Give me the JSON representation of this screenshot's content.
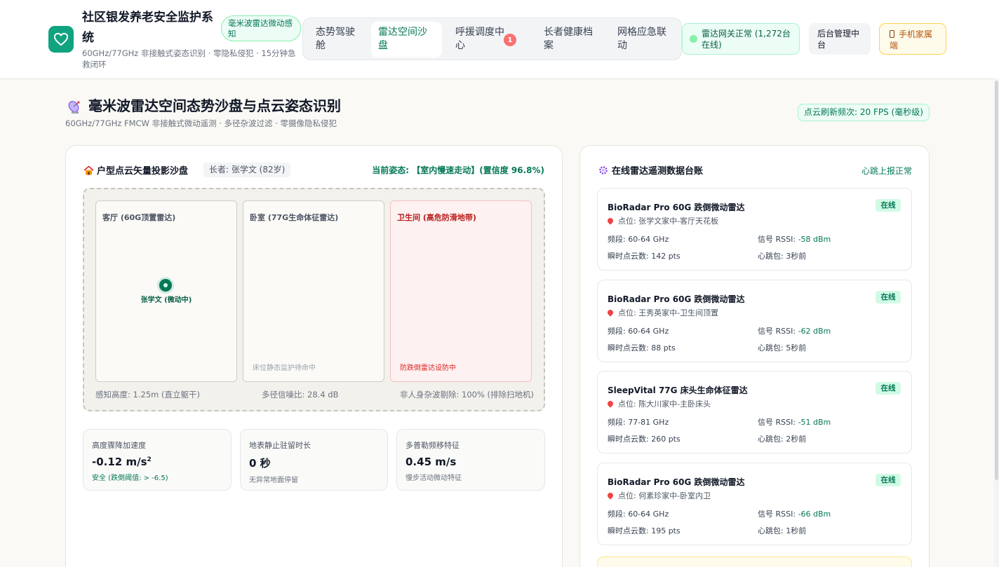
{
  "header": {
    "app_title": "社区银发养老安全监护系统",
    "app_subtitle": "60GHz/77GHz 非接触式姿态识别 · 零隐私侵犯 · 15分钟急救闭环",
    "mmwave_badge": "毫米波雷达微动感知",
    "nav": [
      {
        "label": "态势驾驶舱",
        "active": false
      },
      {
        "label": "雷达空间沙盘",
        "active": true
      },
      {
        "label": "呼援调度中心",
        "active": false,
        "badge": "1"
      },
      {
        "label": "长者健康档案",
        "active": false
      },
      {
        "label": "网格应急联动",
        "active": false
      }
    ],
    "gateway_status": "雷达网关正常 (1,272台在线)",
    "admin_button": "后台管理中台",
    "family_button": "手机家属端",
    "family_icon": "phone-icon",
    "logo_icon": "heart-icon"
  },
  "section": {
    "title": "毫米波雷达空间态势沙盘与点云姿态识别",
    "subtitle": "60GHz/77GHz FMCW 非接触式微动遥测 · 多径杂波过滤 · 零摄像隐私侵犯",
    "fps_badge": "点云刷新频次: 20 FPS (毫秒级)",
    "icon": "satellite-dish-icon"
  },
  "sandbox": {
    "title": "户型点云矢量投影沙盘",
    "icon": "house-icon",
    "elder_tag": "长者: 张学文 (82岁)",
    "posture_text": "当前姿态: 【室内慢速走动】(置信度 96.8%)",
    "rooms": [
      {
        "name": "客厅 (60G顶置雷达)",
        "note": ""
      },
      {
        "name": "卧室 (77G生命体征雷达)",
        "note": "床位静态监护待命中"
      },
      {
        "name": "卫生间 (高危防滑地带)",
        "note": "防跌倒雷达设防中"
      }
    ],
    "target_label": "张学文 (微动中)",
    "footer": {
      "height": "感知高度: 1.25m (直立躯干)",
      "snr": "多径信噪比: 28.4 dB",
      "clutter": "非人身杂波剔除: 100% (排除扫地机)"
    }
  },
  "metrics": [
    {
      "label": "高度骤降加速度",
      "value": "-0.12 m/s",
      "sup": "2",
      "note": "安全 (跌倒阈值: > -6.5)",
      "ok": true
    },
    {
      "label": "地表静止驻留时长",
      "value": "0 秒",
      "sup": "",
      "note": "无异常地面停留",
      "ok": false
    },
    {
      "label": "多普勒频移特征",
      "value": "0.45 m/s",
      "sup": "",
      "note": "慢步活动微动特征",
      "ok": false
    }
  ],
  "ledger": {
    "title": "在线雷达遥测数据台账",
    "icon": "gear-icon",
    "heartbeat": "心跳上报正常",
    "labels": {
      "band": "频段: ",
      "rssi": "信号 RSSI: ",
      "points": "瞬时点云数: ",
      "hb": "心跳包: ",
      "loc": "点位: "
    },
    "devices": [
      {
        "name": "BioRadar Pro 60G 跌倒微动雷达",
        "status": "在线",
        "location": "张学文家中-客厅天花板",
        "band": "60-64 GHz",
        "rssi": "-58 dBm",
        "points": "142 pts",
        "heartbeat": "3秒前"
      },
      {
        "name": "BioRadar Pro 60G 跌倒微动雷达",
        "status": "在线",
        "location": "王秀英家中-卫生间顶置",
        "band": "60-64 GHz",
        "rssi": "-62 dBm",
        "points": "88 pts",
        "heartbeat": "5秒前"
      },
      {
        "name": "SleepVital 77G 床头生命体征雷达",
        "status": "在线",
        "location": "陈大川家中-主卧床头",
        "band": "77-81 GHz",
        "rssi": "-51 dBm",
        "points": "260 pts",
        "heartbeat": "2秒前"
      },
      {
        "name": "BioRadar Pro 60G 跌倒微动雷达",
        "status": "在线",
        "location": "何素珍家中-卧室内卫",
        "band": "60-64 GHz",
        "rssi": "-66 dBm",
        "points": "195 pts",
        "heartbeat": "1秒前"
      }
    ]
  },
  "colors": {
    "brand": "#10a37f",
    "accent_green": "#047857",
    "danger": "#dc2626",
    "warning": "#b45309"
  }
}
